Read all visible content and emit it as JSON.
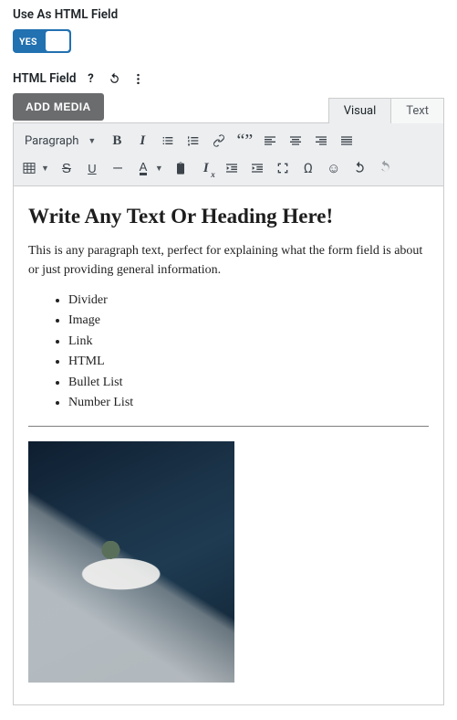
{
  "header": {
    "use_as_label": "Use As HTML Field",
    "toggle_text": "YES"
  },
  "field": {
    "label": "HTML Field",
    "add_media_label": "ADD MEDIA"
  },
  "tabs": {
    "visual": "Visual",
    "text": "Text"
  },
  "toolbar": {
    "format_dropdown": "Paragraph"
  },
  "content": {
    "heading": "Write Any Text Or Heading Here!",
    "paragraph": "This is any paragraph text, perfect for explaining what the form field is about or just providing general information.",
    "list": [
      "Divider",
      "Image",
      "Link",
      "HTML",
      "Bullet List",
      "Number List"
    ]
  }
}
